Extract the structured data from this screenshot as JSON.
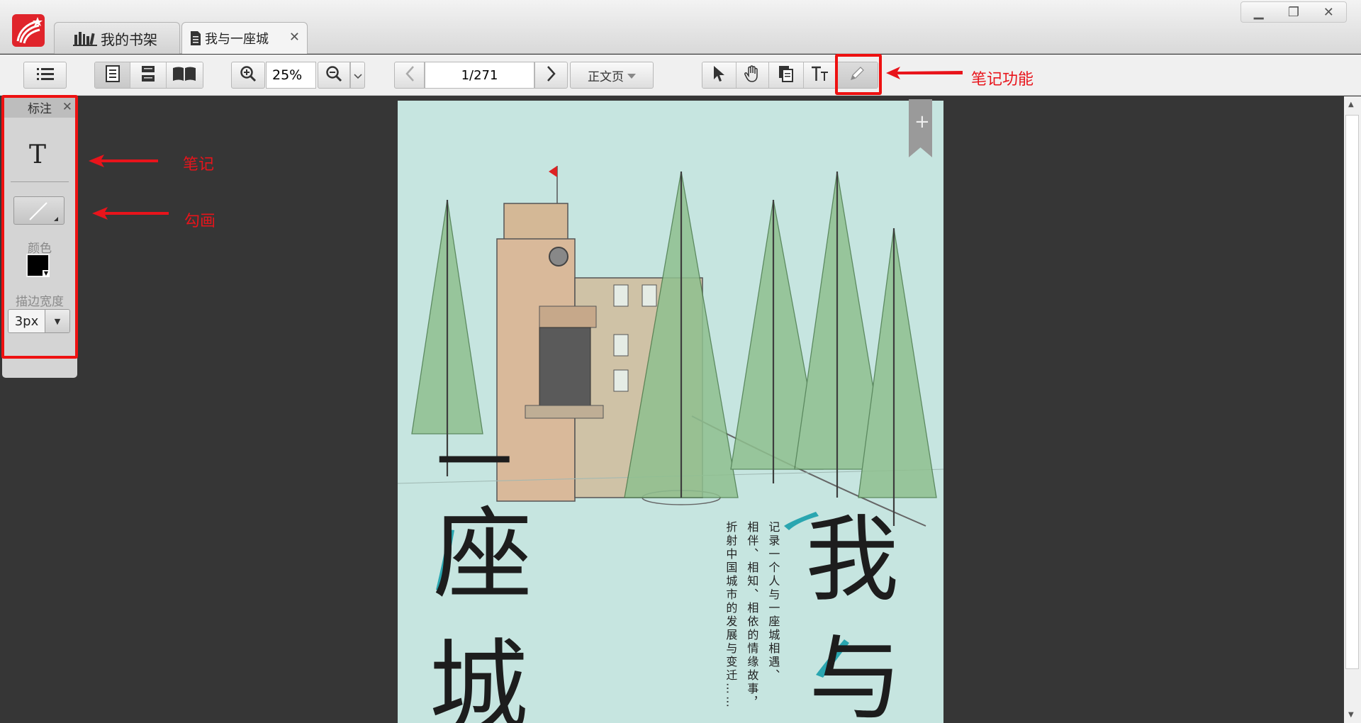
{
  "tabs": [
    {
      "label": "我的书架",
      "icon": "bookshelf-icon"
    },
    {
      "label": "我与一座城",
      "icon": "document-icon"
    }
  ],
  "toolbar": {
    "zoom_value": "25%",
    "page_value": "1/271",
    "body_page_label": "正文页"
  },
  "annotation_panel": {
    "title": "标注",
    "text_tool": "T",
    "color_label": "颜色",
    "color_value": "#000000",
    "stroke_label": "描边宽度",
    "stroke_value": "3px"
  },
  "callouts": {
    "note_feature": "笔记功能",
    "note": "笔记",
    "draw": "勾画"
  },
  "cover": {
    "title_chars_left": [
      "一",
      "座",
      "城"
    ],
    "title_chars_right": [
      "我",
      "与"
    ],
    "blurb_col1": "记录一个人与一座城相遇、",
    "blurb_col2": "相伴、相知、相依的情缘故事，",
    "blurb_col3": "折射中国城市的发展与变迁……",
    "bookmark_symbol": "+"
  },
  "colors": {
    "accent_red": "#e8141b",
    "cover_teal": "#c6e5e0",
    "title_teal": "#2aa6b0"
  }
}
